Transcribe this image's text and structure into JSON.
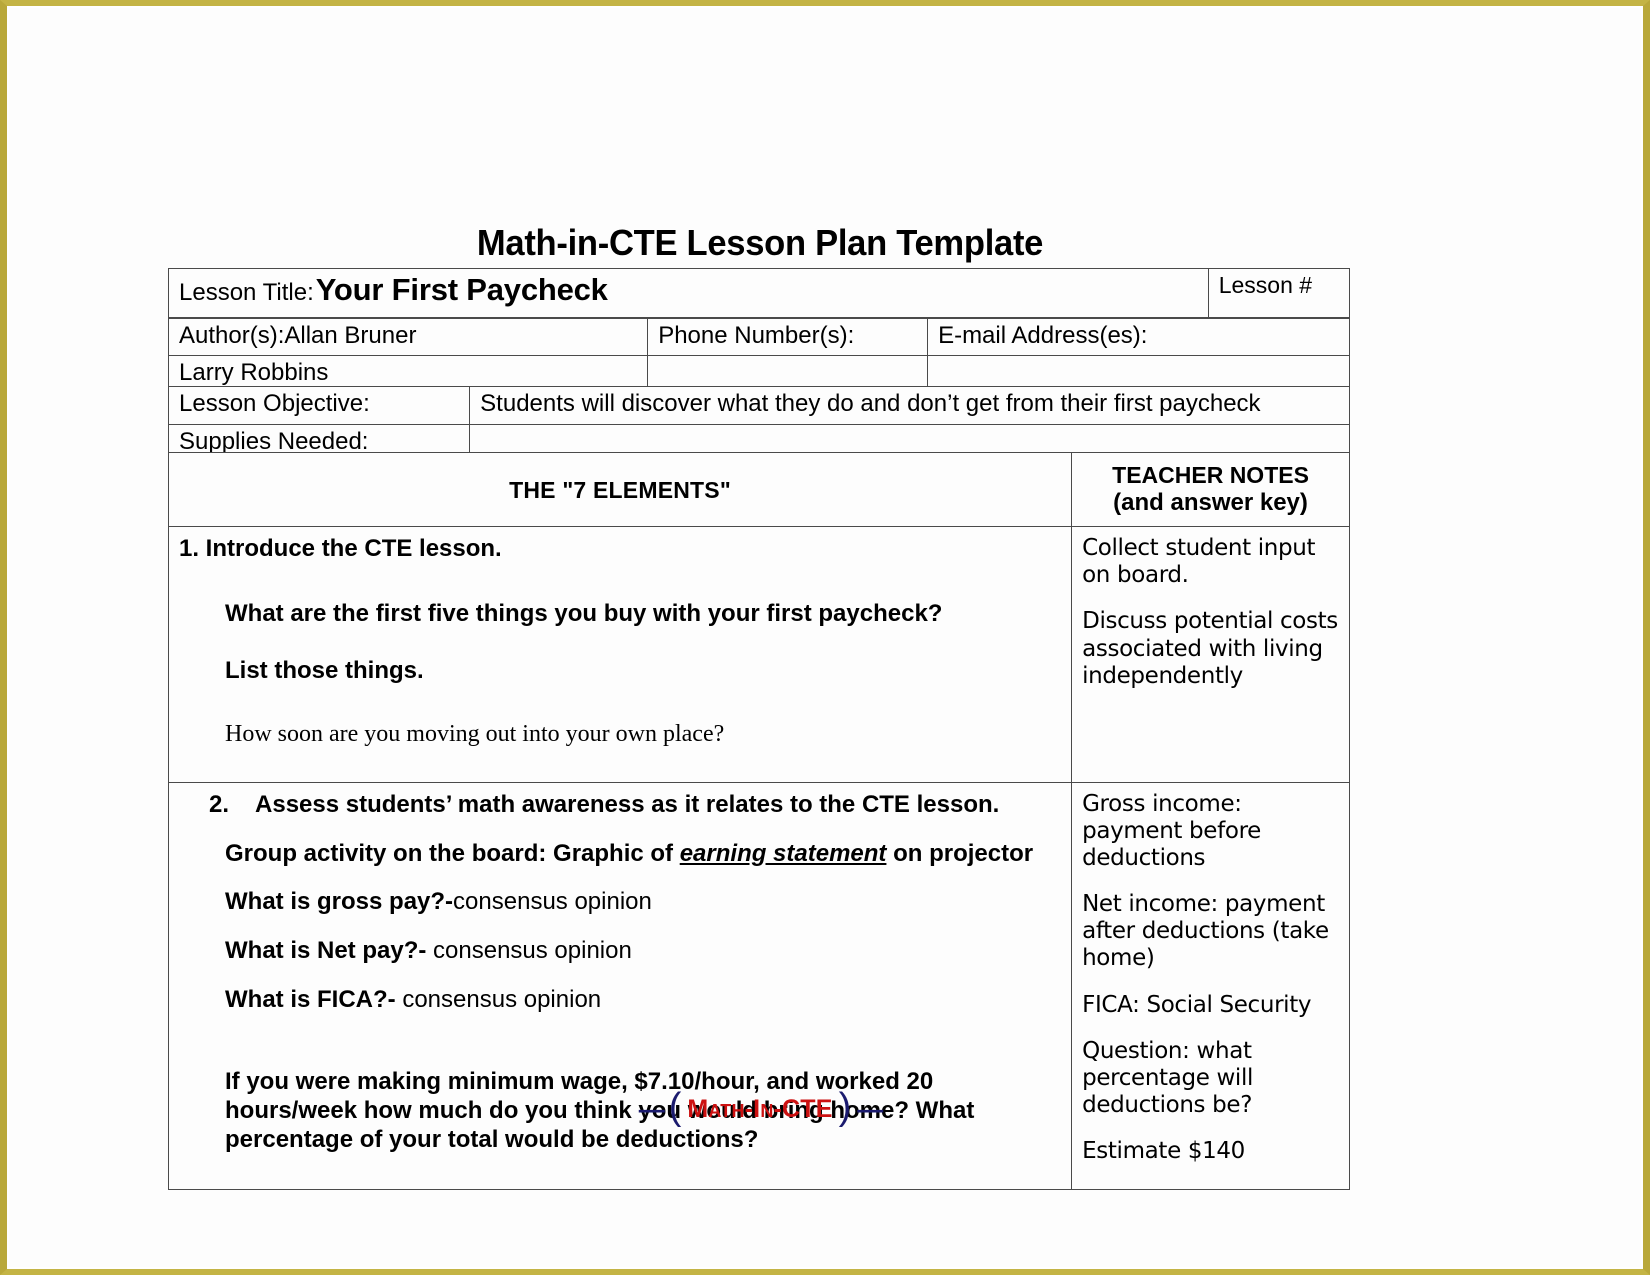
{
  "document": {
    "title": "Math-in-CTE Lesson Plan Template"
  },
  "header": {
    "lesson_title_label": "Lesson Title:",
    "lesson_title_value": "Your First Paycheck",
    "lesson_number_label": "Lesson #",
    "authors_label": "Author(s):Allan Bruner",
    "authors_line2": "Larry Robbins",
    "phone_label": "Phone Number(s):",
    "phone_value": "",
    "email_label": "E-mail Address(es):",
    "email_value": "",
    "objective_label": "Lesson Objective:",
    "objective_value": "Students will discover what they do and don’t get from their first paycheck",
    "supplies_label": "Supplies Needed:",
    "supplies_value": ""
  },
  "main_table": {
    "col_elements_header": "THE \"7 ELEMENTS\"",
    "col_notes_header": "TEACHER NOTES",
    "col_notes_subheader": "(and answer key)",
    "rows": [
      {
        "element_heading": "1. Introduce the CTE lesson.",
        "element_q1": "What are the first five things you buy with your first paycheck?",
        "element_q2": "List those things.",
        "element_serif_line": "How soon are you moving out into your own place?",
        "notes": [
          "Collect student input on board.",
          "Discuss potential costs associated with living independently"
        ]
      },
      {
        "element_number": "2.",
        "element_heading": "Assess students’ math awareness as it relates to the CTE lesson.",
        "group_activity_prefix": "Group activity on the board:  Graphic of ",
        "group_activity_emphasis": "earning statement",
        "group_activity_suffix": " on projector",
        "q_gross_bold": "What is gross pay?-",
        "q_gross_reg": "consensus opinion",
        "q_net_bold": "What is Net pay?-",
        "q_net_reg": " consensus opinion",
        "q_fica_bold": "What is FICA?-",
        "q_fica_reg": " consensus opinion",
        "wage_paragraph": "If you were making minimum wage, $7.10/hour, and worked 20 hours/week how much do you think you would bring home?  What percentage of your total would be deductions?",
        "notes": [
          "Gross income: payment before deductions",
          "Net income:  payment after deductions (take home)",
          "FICA: Social Security",
          "Question: what percentage will deductions be?",
          "Estimate $140"
        ]
      }
    ]
  },
  "footer": {
    "logo_dash_left": "—",
    "logo_paren_left": "(",
    "logo_text": "Math-In-CTE",
    "logo_paren_right": ")",
    "logo_dash_right": "—"
  },
  "colors": {
    "page_border": "#b9a83a",
    "logo_red": "#cc1111",
    "logo_navy": "#1b1b6e",
    "rule": "#4a4a4a"
  }
}
